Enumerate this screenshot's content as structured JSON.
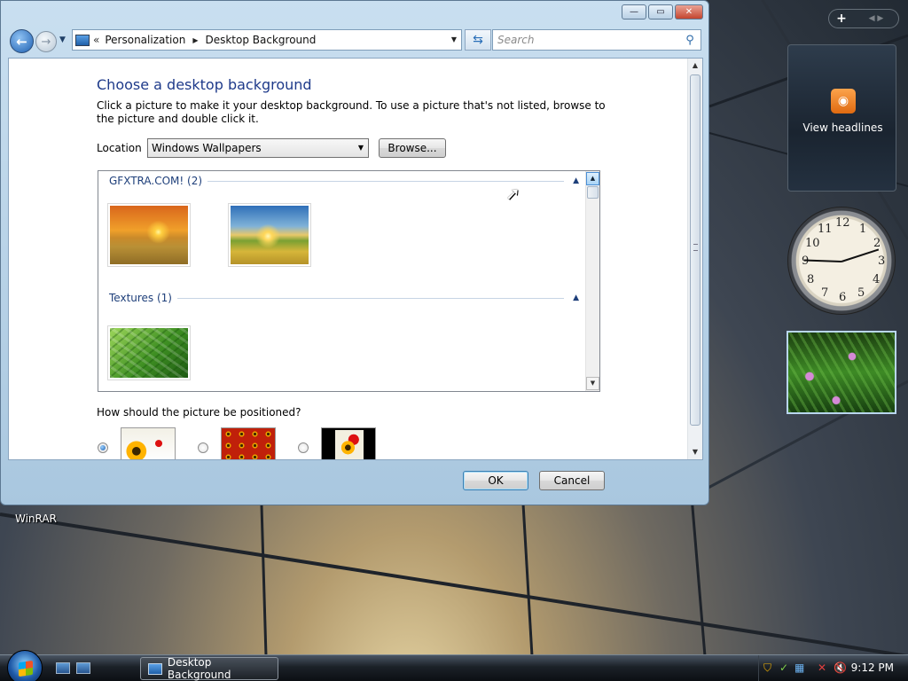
{
  "window": {
    "breadcrumb": [
      "Personalization",
      "Desktop Background"
    ],
    "search_placeholder": "Search",
    "caption": {
      "minimize": "—",
      "maximize": "▭",
      "close": "✕"
    }
  },
  "content": {
    "title": "Choose a desktop background",
    "description": "Click a picture to make it your desktop background. To use a picture that's not listed, browse to the picture and double click it.",
    "location_label": "Location",
    "location_value": "Windows Wallpapers",
    "browse_label": "Browse...",
    "groups": [
      {
        "name": "GFXTRA.COM! (2)",
        "items": [
          "sunset-field",
          "sunrise-field"
        ]
      },
      {
        "name": "Textures (1)",
        "items": [
          "fern"
        ]
      }
    ],
    "position_label": "How should the picture be positioned?",
    "position_options": [
      {
        "name": "fill",
        "selected": true
      },
      {
        "name": "tile",
        "selected": false
      },
      {
        "name": "center",
        "selected": false
      }
    ],
    "ok_label": "OK",
    "cancel_label": "Cancel"
  },
  "desktop": {
    "icon_label": "WinRAR"
  },
  "sidebar": {
    "feed_text": "View headlines",
    "clock_time": "9:12",
    "colors": {
      "rss": "#f08a24"
    }
  },
  "taskbar": {
    "task_label": "Desktop Background",
    "time": "9:12 PM"
  }
}
